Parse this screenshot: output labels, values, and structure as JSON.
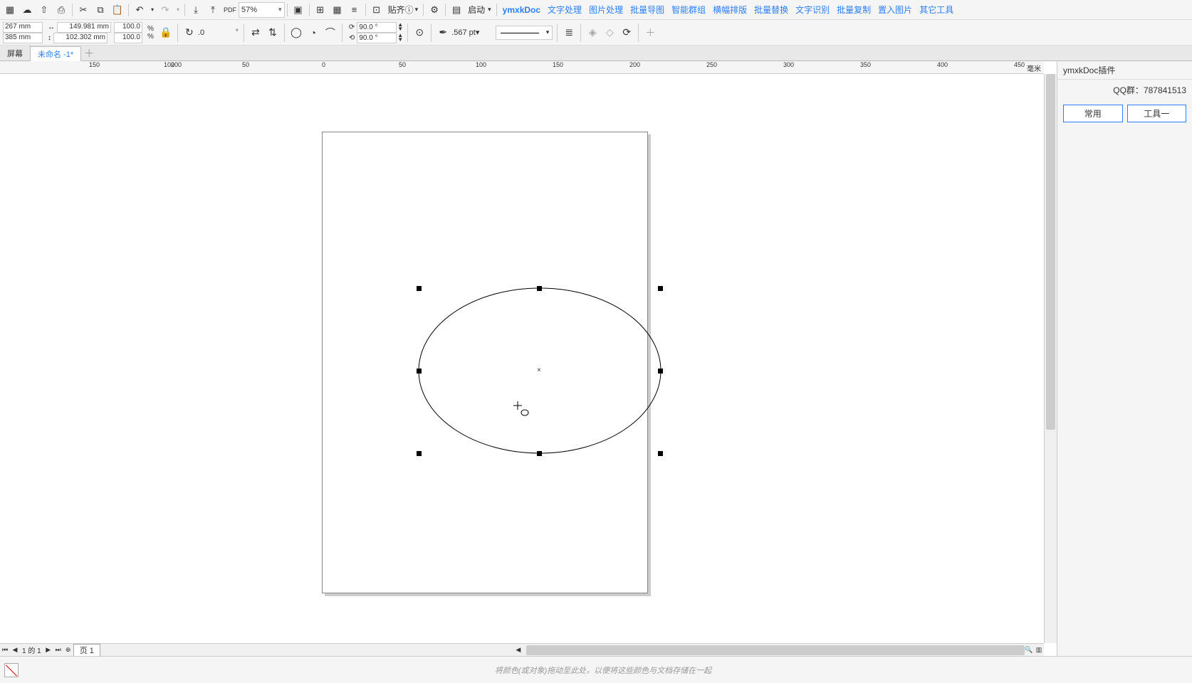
{
  "toolbar": {
    "zoom": "57%",
    "align_label": "贴齐",
    "launch_label": "启动",
    "links": [
      "ymxkDoc",
      "文字处理",
      "图片处理",
      "批量导图",
      "智能群组",
      "横幅排版",
      "批量替换",
      "文字识别",
      "批量复制",
      "置入图片",
      "其它工具"
    ]
  },
  "props": {
    "x": "267 mm",
    "y": "385 mm",
    "w": "149.981 mm",
    "h": "102.302 mm",
    "sx": "100.0",
    "sy": "100.0",
    "pct": "%",
    "rot": ".0",
    "deg": "°",
    "ang1": "90.0 °",
    "ang2": "90.0 °",
    "outline": ".567 pt"
  },
  "tabs": {
    "t1": "屏幕",
    "t2": "未命名 -1*"
  },
  "ruler": {
    "unit": "毫米",
    "ticks": [
      "200",
      "150",
      "100",
      "50",
      "0",
      "50",
      "100",
      "150",
      "200",
      "250",
      "300",
      "350",
      "400",
      "450"
    ]
  },
  "pagebar": {
    "count": "1 的 1",
    "page1": "页 1"
  },
  "panel": {
    "title": "ymxkDoc插件",
    "qq": "QQ群：787841513",
    "b1": "常用",
    "b2": "工具一"
  },
  "status": {
    "hint": "将颜色(或对象)拖动至此处，以便将这些颜色与文档存储在一起"
  }
}
